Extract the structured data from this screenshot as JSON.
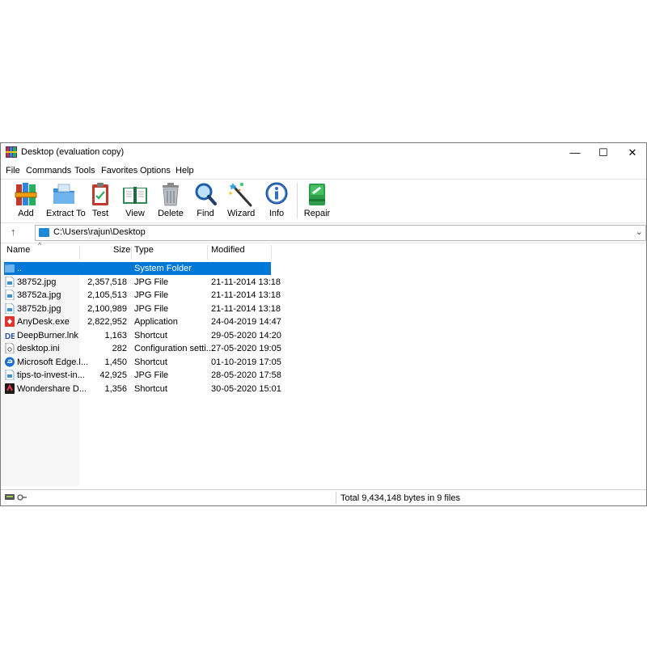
{
  "window": {
    "title": "Desktop (evaluation copy)",
    "controls": {
      "minimize": "—",
      "maximize": "☐",
      "close": "✕"
    }
  },
  "menu": [
    "File",
    "Commands",
    "Tools",
    "Favorites",
    "Options",
    "Help"
  ],
  "toolbar": [
    {
      "label": "Add",
      "icon": "archive-books-icon"
    },
    {
      "label": "Extract To",
      "icon": "folder-extract-icon"
    },
    {
      "label": "Test",
      "icon": "clipboard-check-icon"
    },
    {
      "label": "View",
      "icon": "open-book-icon"
    },
    {
      "label": "Delete",
      "icon": "trash-can-icon"
    },
    {
      "label": "Find",
      "icon": "magnifier-icon"
    },
    {
      "label": "Wizard",
      "icon": "magic-wand-icon"
    },
    {
      "label": "Info",
      "icon": "info-icon"
    },
    {
      "label": "Repair",
      "icon": "first-aid-kit-icon"
    }
  ],
  "address": {
    "path": "C:\\Users\\rajun\\Desktop",
    "up_glyph": "↑",
    "dropdown_glyph": "⌄"
  },
  "columns": {
    "name": "Name",
    "size": "Size",
    "type": "Type",
    "modified": "Modified"
  },
  "files": [
    {
      "name": "..",
      "size": "",
      "type": "System Folder",
      "modified": "",
      "icon": "folder-icon",
      "selected": true
    },
    {
      "name": "38752.jpg",
      "size": "2,357,518",
      "type": "JPG File",
      "modified": "21-11-2014 13:18",
      "icon": "image-file-icon"
    },
    {
      "name": "38752a.jpg",
      "size": "2,105,513",
      "type": "JPG File",
      "modified": "21-11-2014 13:18",
      "icon": "image-file-icon"
    },
    {
      "name": "38752b.jpg",
      "size": "2,100,989",
      "type": "JPG File",
      "modified": "21-11-2014 13:18",
      "icon": "image-file-icon"
    },
    {
      "name": "AnyDesk.exe",
      "size": "2,822,952",
      "type": "Application",
      "modified": "24-04-2019 14:47",
      "icon": "anydesk-icon"
    },
    {
      "name": "DeepBurner.lnk",
      "size": "1,163",
      "type": "Shortcut",
      "modified": "29-05-2020 14:20",
      "icon": "deepburner-icon"
    },
    {
      "name": "desktop.ini",
      "size": "282",
      "type": "Configuration setti...",
      "modified": "27-05-2020 19:05",
      "icon": "settings-file-icon"
    },
    {
      "name": "Microsoft Edge.l...",
      "size": "1,450",
      "type": "Shortcut",
      "modified": "01-10-2019 17:05",
      "icon": "edge-icon"
    },
    {
      "name": "tips-to-invest-in...",
      "size": "42,925",
      "type": "JPG File",
      "modified": "28-05-2020 17:58",
      "icon": "image-file-icon"
    },
    {
      "name": "Wondershare D...",
      "size": "1,356",
      "type": "Shortcut",
      "modified": "30-05-2020 15:01",
      "icon": "wondershare-icon"
    }
  ],
  "status": {
    "text": "Total 9,434,148 bytes in 9 files"
  },
  "colors": {
    "selection": "#0078d7",
    "accent": "#1e88d8"
  }
}
